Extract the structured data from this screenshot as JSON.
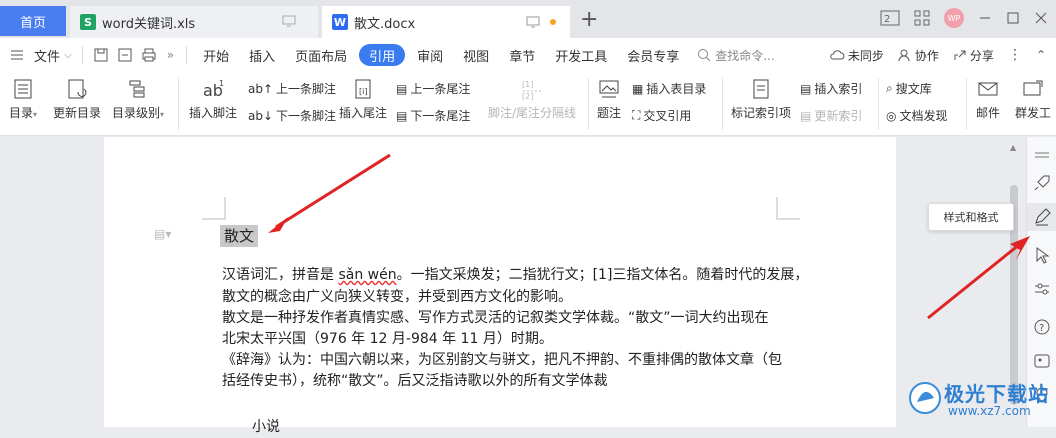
{
  "tabs": {
    "home": "首页",
    "xls": "word关键词.xls",
    "docx": "散文.docx",
    "add": "+"
  },
  "window": {
    "avatar": "WP"
  },
  "menubar": {
    "file": "文件",
    "items": [
      "开始",
      "插入",
      "页面布局",
      "引用",
      "审阅",
      "视图",
      "章节",
      "开发工具",
      "会员专享"
    ],
    "active_index": 3,
    "search": "查找命令...",
    "unsync": "未同步",
    "collab": "协作",
    "share": "分享"
  },
  "ribbon": {
    "toc": "目录",
    "update_toc": "更新目录",
    "toc_level": "目录级别",
    "insert_footnote": "插入脚注",
    "prev_footnote": "上一条脚注",
    "next_footnote": "下一条脚注",
    "insert_endnote": "插入尾注",
    "prev_endnote": "上一条尾注",
    "next_endnote": "下一条尾注",
    "footnote_sep": "脚注/尾注分隔线",
    "caption": "题注",
    "insert_table_toc": "插入表目录",
    "cross_ref": "交叉引用",
    "mark_index": "标记索引项",
    "insert_index": "插入索引",
    "update_index": "更新索引",
    "search_library": "搜文库",
    "doc_discover": "文档发现",
    "mail": "邮件",
    "group_send": "群发工"
  },
  "document": {
    "title": "散文",
    "pinyin": "sǎn wén",
    "para1_a": "汉语词汇，拼音是 ",
    "para1_b": "。一指文采焕发；二指犹行文；[1]三指文体名。随着时代的发展，",
    "para1_line2": "散文的概念由广义向狭义转变，并受到西方文化的影响。",
    "para2_line1": "散文是一种抒发作者真情实感、写作方式灵活的记叙类文学体裁。“散文”一词大约出现在",
    "para2_line2": "北宋太平兴国（976 年 12 月-984 年 11 月）时期。",
    "para3_line1": "《辞海》认为：中国六朝以来，为区别韵文与骈文，把凡不押韵、不重排偶的散体文章（包",
    "para3_line2": "括经传史书），统称“散文”。后又泛指诗歌以外的所有文学体裁",
    "next_heading": "小说"
  },
  "sidepanel": {
    "tooltip": "样式和格式"
  },
  "watermark": {
    "text": "极光下载站",
    "url": "www.xz7.com"
  },
  "colors": {
    "accent": "#3a7bf0",
    "arrow": "#e02424",
    "selection": "#c8c8c8"
  }
}
